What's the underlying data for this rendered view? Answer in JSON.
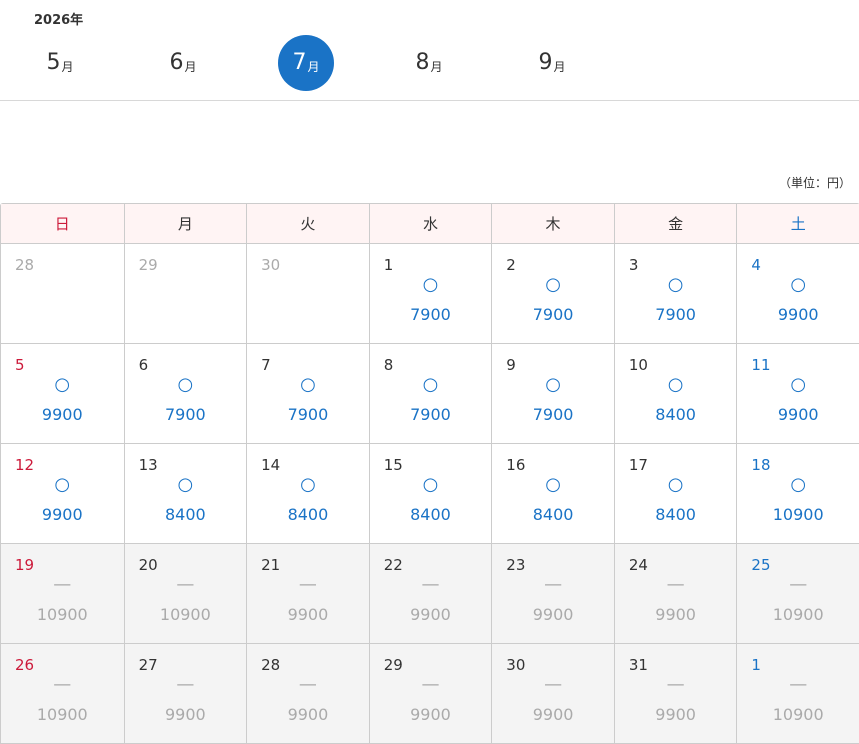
{
  "year_label": "2026年",
  "months": [
    {
      "num": "5",
      "unit": "月",
      "active": false
    },
    {
      "num": "6",
      "unit": "月",
      "active": false
    },
    {
      "num": "7",
      "unit": "月",
      "active": true
    },
    {
      "num": "8",
      "unit": "月",
      "active": false
    },
    {
      "num": "9",
      "unit": "月",
      "active": false
    }
  ],
  "unit_note": "（単位：円）",
  "weekdays": [
    "日",
    "月",
    "火",
    "水",
    "木",
    "金",
    "土"
  ],
  "colors": {
    "accent": "#1a73c6",
    "sunday": "#cc1a3a",
    "muted": "#aaaaaa"
  },
  "weeks": [
    [
      {
        "day": "28",
        "mark": "",
        "price": "",
        "state": "out"
      },
      {
        "day": "29",
        "mark": "",
        "price": "",
        "state": "out"
      },
      {
        "day": "30",
        "mark": "",
        "price": "",
        "state": "out"
      },
      {
        "day": "1",
        "mark": "○",
        "price": "7900",
        "state": "available"
      },
      {
        "day": "2",
        "mark": "○",
        "price": "7900",
        "state": "available"
      },
      {
        "day": "3",
        "mark": "○",
        "price": "7900",
        "state": "available"
      },
      {
        "day": "4",
        "mark": "○",
        "price": "9900",
        "state": "available"
      }
    ],
    [
      {
        "day": "5",
        "mark": "○",
        "price": "9900",
        "state": "available"
      },
      {
        "day": "6",
        "mark": "○",
        "price": "7900",
        "state": "available"
      },
      {
        "day": "7",
        "mark": "○",
        "price": "7900",
        "state": "available"
      },
      {
        "day": "8",
        "mark": "○",
        "price": "7900",
        "state": "available"
      },
      {
        "day": "9",
        "mark": "○",
        "price": "7900",
        "state": "available"
      },
      {
        "day": "10",
        "mark": "○",
        "price": "8400",
        "state": "available"
      },
      {
        "day": "11",
        "mark": "○",
        "price": "9900",
        "state": "available"
      }
    ],
    [
      {
        "day": "12",
        "mark": "○",
        "price": "9900",
        "state": "available"
      },
      {
        "day": "13",
        "mark": "○",
        "price": "8400",
        "state": "available"
      },
      {
        "day": "14",
        "mark": "○",
        "price": "8400",
        "state": "available"
      },
      {
        "day": "15",
        "mark": "○",
        "price": "8400",
        "state": "available"
      },
      {
        "day": "16",
        "mark": "○",
        "price": "8400",
        "state": "available"
      },
      {
        "day": "17",
        "mark": "○",
        "price": "8400",
        "state": "available"
      },
      {
        "day": "18",
        "mark": "○",
        "price": "10900",
        "state": "available"
      }
    ],
    [
      {
        "day": "19",
        "mark": "—",
        "price": "10900",
        "state": "closed"
      },
      {
        "day": "20",
        "mark": "—",
        "price": "10900",
        "state": "closed"
      },
      {
        "day": "21",
        "mark": "—",
        "price": "9900",
        "state": "closed"
      },
      {
        "day": "22",
        "mark": "—",
        "price": "9900",
        "state": "closed"
      },
      {
        "day": "23",
        "mark": "—",
        "price": "9900",
        "state": "closed"
      },
      {
        "day": "24",
        "mark": "—",
        "price": "9900",
        "state": "closed"
      },
      {
        "day": "25",
        "mark": "—",
        "price": "10900",
        "state": "closed"
      }
    ],
    [
      {
        "day": "26",
        "mark": "—",
        "price": "10900",
        "state": "closed"
      },
      {
        "day": "27",
        "mark": "—",
        "price": "9900",
        "state": "closed"
      },
      {
        "day": "28",
        "mark": "—",
        "price": "9900",
        "state": "closed"
      },
      {
        "day": "29",
        "mark": "—",
        "price": "9900",
        "state": "closed"
      },
      {
        "day": "30",
        "mark": "—",
        "price": "9900",
        "state": "closed"
      },
      {
        "day": "31",
        "mark": "—",
        "price": "9900",
        "state": "closed"
      },
      {
        "day": "1",
        "mark": "—",
        "price": "10900",
        "state": "closed"
      }
    ]
  ]
}
